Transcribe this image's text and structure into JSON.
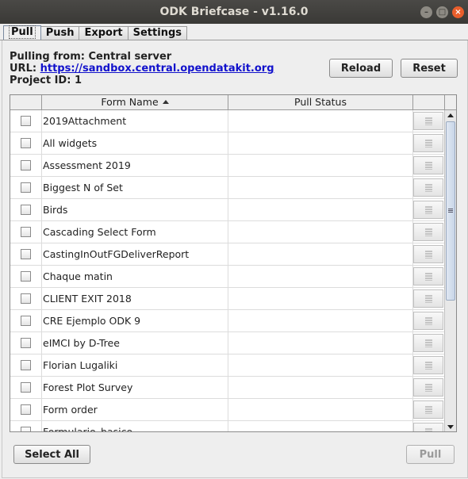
{
  "window": {
    "title": "ODK Briefcase - v1.16.0"
  },
  "tabs": [
    {
      "label": "Pull"
    },
    {
      "label": "Push"
    },
    {
      "label": "Export"
    },
    {
      "label": "Settings"
    }
  ],
  "source": {
    "pulling_from": "Pulling from: Central server",
    "url_label": "URL:",
    "url": "https://sandbox.central.opendatakit.org",
    "project_id": "Project ID: 1"
  },
  "buttons": {
    "reload": "Reload",
    "reset": "Reset",
    "select_all": "Select All",
    "pull": "Pull"
  },
  "table": {
    "columns": [
      "",
      "Form Name",
      "Pull Status",
      ""
    ],
    "sort_column": "Form Name",
    "rows": [
      {
        "name": "2019Attachment",
        "status": ""
      },
      {
        "name": "All widgets",
        "status": ""
      },
      {
        "name": "Assessment 2019",
        "status": ""
      },
      {
        "name": "Biggest N of Set",
        "status": ""
      },
      {
        "name": "Birds",
        "status": ""
      },
      {
        "name": "Cascading Select Form",
        "status": ""
      },
      {
        "name": "CastingInOutFGDeliverReport",
        "status": ""
      },
      {
        "name": "Chaque matin",
        "status": ""
      },
      {
        "name": "CLIENT EXIT 2018",
        "status": ""
      },
      {
        "name": "CRE Ejemplo ODK 9",
        "status": ""
      },
      {
        "name": "eIMCI by D-Tree",
        "status": ""
      },
      {
        "name": "Florian Lugaliki",
        "status": ""
      },
      {
        "name": "Forest Plot Survey",
        "status": ""
      },
      {
        "name": "Form order",
        "status": ""
      },
      {
        "name": "Formulario_basico",
        "status": ""
      }
    ]
  }
}
